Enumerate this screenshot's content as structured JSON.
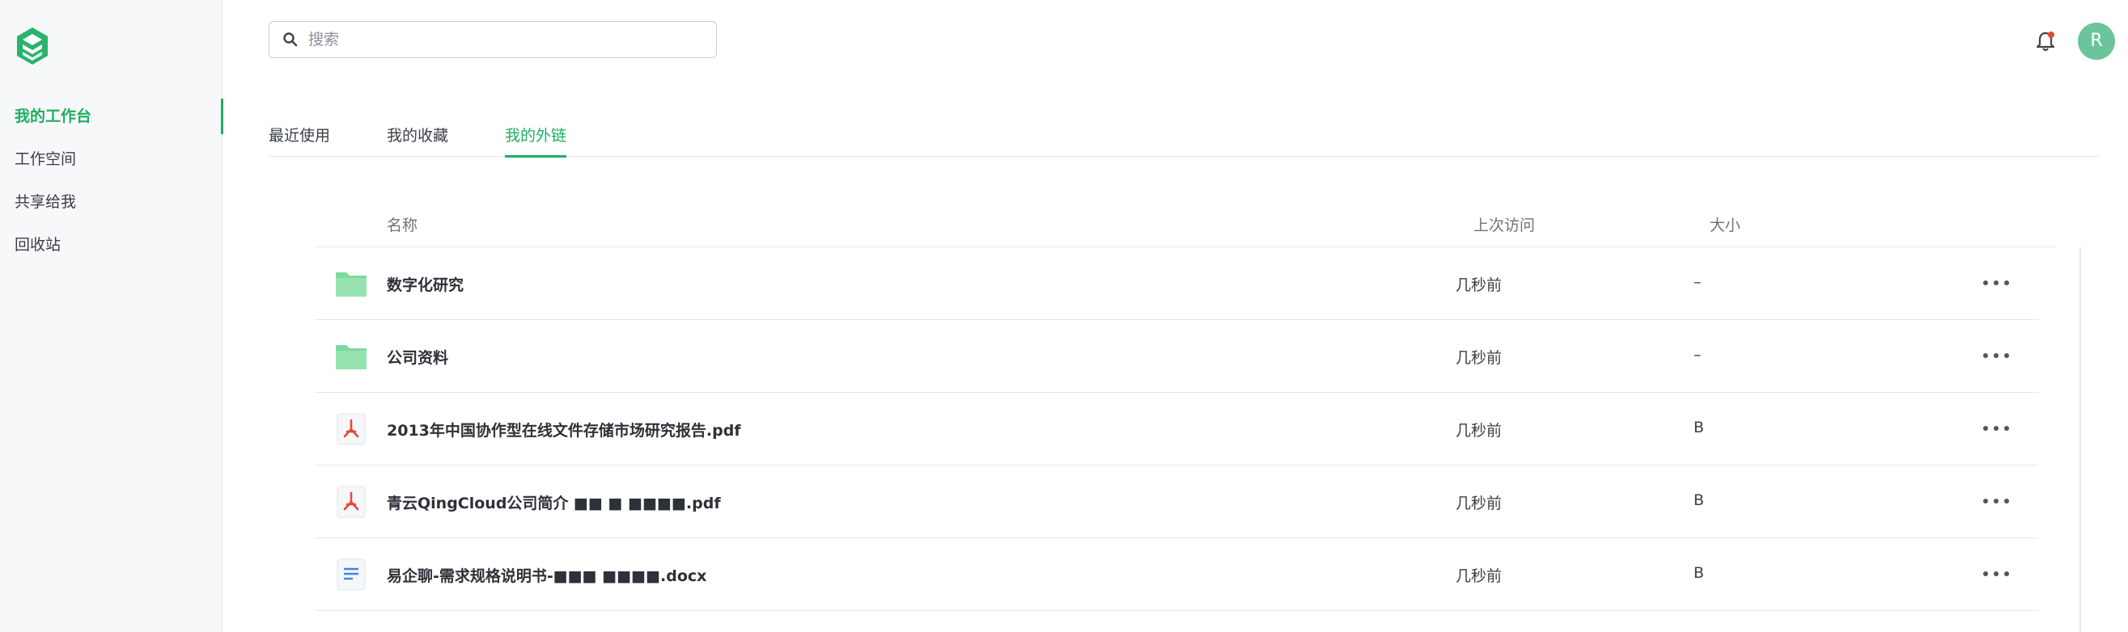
{
  "search": {
    "placeholder": "搜索"
  },
  "sidebar": {
    "items": [
      {
        "label": "我的工作台"
      },
      {
        "label": "工作空间"
      },
      {
        "label": "共享给我"
      },
      {
        "label": "回收站"
      }
    ]
  },
  "header": {
    "avatar_initial": "R"
  },
  "tabs": [
    {
      "label": "最近使用"
    },
    {
      "label": "我的收藏"
    },
    {
      "label": "我的外链"
    }
  ],
  "table": {
    "columns": {
      "name": "名称",
      "last_visit": "上次访问",
      "size": "大小"
    },
    "rows": [
      {
        "name": "数字化研究",
        "last_visit": "几秒前",
        "size": "–",
        "icon": "folder-icon"
      },
      {
        "name": "公司资料",
        "last_visit": "几秒前",
        "size": "–",
        "icon": "folder-icon"
      },
      {
        "name": "2013年中国协作型在线文件存储市场研究报告.pdf",
        "last_visit": "几秒前",
        "size": "B",
        "icon": "pdf-icon"
      },
      {
        "name": "青云QingCloud公司简介 ■■ ■ ■■■■.pdf",
        "last_visit": "几秒前",
        "size": "B",
        "icon": "pdf-icon"
      },
      {
        "name": "易企聊-需求规格说明书-■■■ ■■■■.docx",
        "last_visit": "几秒前",
        "size": "B",
        "icon": "doc-icon"
      }
    ]
  },
  "colors": {
    "accent": "#1fae61",
    "folder": "#7ed99d",
    "pdf": "#e5483a",
    "doc": "#3d84e6"
  }
}
